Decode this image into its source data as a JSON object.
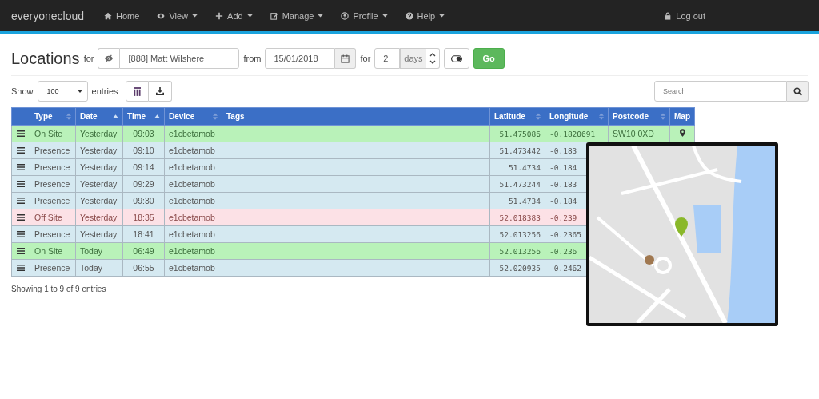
{
  "navbar": {
    "brand": "everyonecloud",
    "items": [
      {
        "label": "Home",
        "dropdown": false
      },
      {
        "label": "View",
        "dropdown": true
      },
      {
        "label": "Add",
        "dropdown": true
      },
      {
        "label": "Manage",
        "dropdown": true
      },
      {
        "label": "Profile",
        "dropdown": true
      },
      {
        "label": "Help",
        "dropdown": true
      }
    ],
    "logout": "Log out"
  },
  "filter": {
    "title": "Locations",
    "for_label": "for",
    "person": "[888] Matt Wilshere",
    "from_label": "from",
    "date": "15/01/2018",
    "for_label_2": "for",
    "days_value": "2",
    "days_unit": "days",
    "go": "Go"
  },
  "controls": {
    "show_label": "Show",
    "page_size": "100",
    "entries_label": "entries",
    "search_placeholder": "Search"
  },
  "table": {
    "columns": [
      {
        "sortable": false
      },
      {
        "label": "Type",
        "sortable": true,
        "sorted": false
      },
      {
        "label": "Date",
        "sortable": true,
        "sorted": true
      },
      {
        "label": "Time",
        "sortable": true,
        "sorted": true
      },
      {
        "label": "Device",
        "sortable": true,
        "sorted": false
      },
      {
        "label": "Tags",
        "sortable": false
      },
      {
        "label": "Latitude",
        "sortable": true,
        "sorted": false
      },
      {
        "label": "Longitude",
        "sortable": true,
        "sorted": false
      },
      {
        "label": "Postcode",
        "sortable": true,
        "sorted": false
      },
      {
        "label": "Map",
        "sortable": false
      }
    ],
    "rows": [
      {
        "kind": "on_site",
        "type": "On Site",
        "date": "Yesterday",
        "time": "09:03",
        "device": "e1cbetamob",
        "latitude": "51.475086",
        "longitude": "-0.1820691",
        "postcode": "SW10 0XD",
        "pin": true
      },
      {
        "kind": "presence",
        "type": "Presence",
        "date": "Yesterday",
        "time": "09:10",
        "device": "e1cbetamob",
        "latitude": "51.473442",
        "longitude": "-0.183"
      },
      {
        "kind": "presence",
        "type": "Presence",
        "date": "Yesterday",
        "time": "09:14",
        "device": "e1cbetamob",
        "latitude": "51.4734",
        "longitude": "-0.184"
      },
      {
        "kind": "presence",
        "type": "Presence",
        "date": "Yesterday",
        "time": "09:29",
        "device": "e1cbetamob",
        "latitude": "51.473244",
        "longitude": "-0.183"
      },
      {
        "kind": "presence",
        "type": "Presence",
        "date": "Yesterday",
        "time": "09:30",
        "device": "e1cbetamob",
        "latitude": "51.4734",
        "longitude": "-0.184"
      },
      {
        "kind": "off_site",
        "type": "Off Site",
        "date": "Yesterday",
        "time": "18:35",
        "device": "e1cbetamob",
        "latitude": "52.018383",
        "longitude": "-0.239"
      },
      {
        "kind": "presence",
        "type": "Presence",
        "date": "Yesterday",
        "time": "18:41",
        "device": "e1cbetamob",
        "latitude": "52.013256",
        "longitude": "-0.2365"
      },
      {
        "kind": "on_site",
        "type": "On Site",
        "date": "Today",
        "time": "06:49",
        "device": "e1cbetamob",
        "latitude": "52.013256",
        "longitude": "-0.236"
      },
      {
        "kind": "presence",
        "type": "Presence",
        "date": "Today",
        "time": "06:55",
        "device": "e1cbetamob",
        "latitude": "52.020935",
        "longitude": "-0.2462"
      }
    ]
  },
  "footer": "Showing 1 to 9 of 9 entries"
}
